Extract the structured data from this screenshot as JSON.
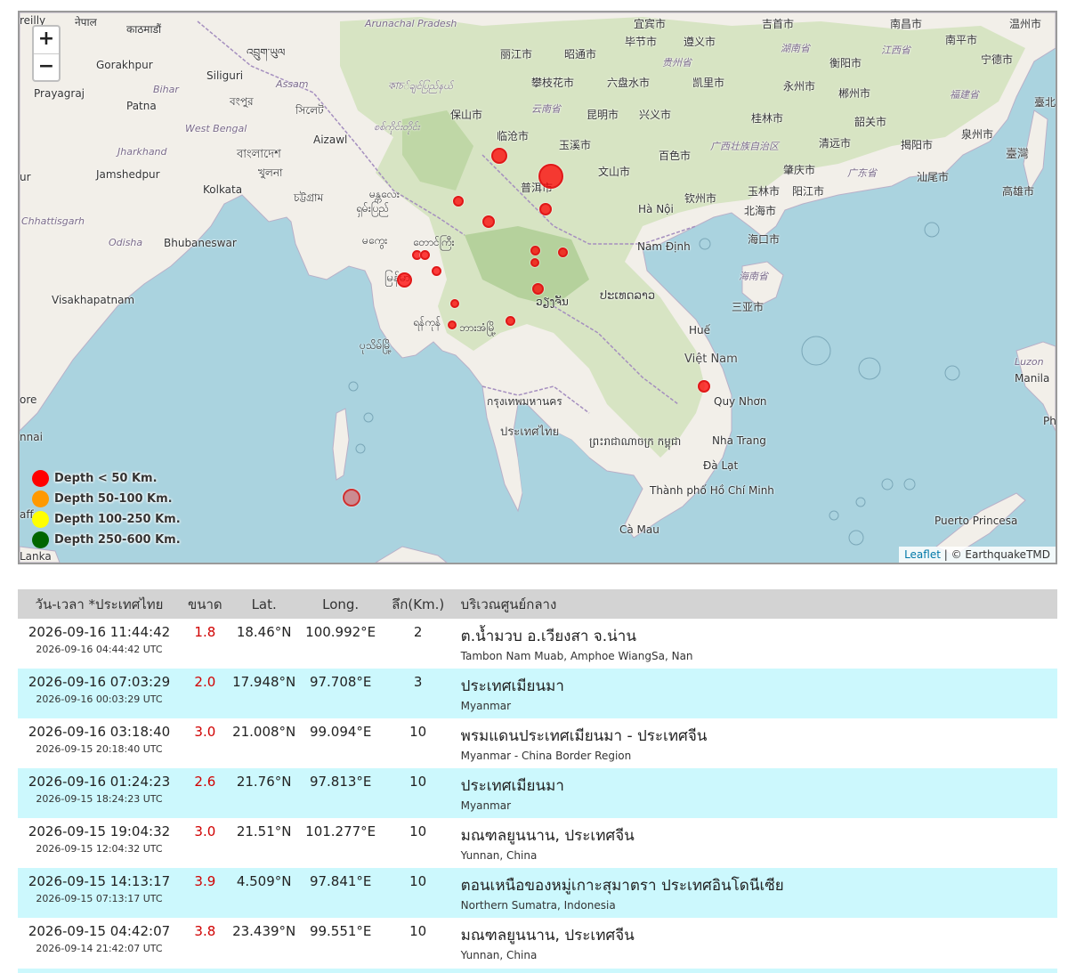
{
  "map": {
    "zoom_in": "+",
    "zoom_out": "−",
    "labels": [
      {
        "text": "reilly",
        "kind": "normal"
      },
      {
        "text": "नेपाल",
        "kind": "normal"
      },
      {
        "text": "काठमाडौं",
        "kind": "normal"
      },
      {
        "text": "Arunachal Pradesh",
        "kind": "italic"
      },
      {
        "text": "宜宾市",
        "kind": "normal"
      },
      {
        "text": "吉首市",
        "kind": "normal"
      },
      {
        "text": "南昌市",
        "kind": "normal"
      },
      {
        "text": "温州市",
        "kind": "normal"
      },
      {
        "text": "Gorakhpur",
        "kind": "normal"
      },
      {
        "text": "འབྲུག་ཡུལ",
        "kind": "normal"
      },
      {
        "text": "丽江市",
        "kind": "normal"
      },
      {
        "text": "昭通市",
        "kind": "normal"
      },
      {
        "text": "毕节市",
        "kind": "normal"
      },
      {
        "text": "遵义市",
        "kind": "normal"
      },
      {
        "text": "湖南省",
        "kind": "italic"
      },
      {
        "text": "南平市",
        "kind": "normal"
      },
      {
        "text": "宁德市",
        "kind": "normal"
      },
      {
        "text": "Prayagraj",
        "kind": "normal"
      },
      {
        "text": "Bihar",
        "kind": "italic"
      },
      {
        "text": "Siliguri",
        "kind": "normal"
      },
      {
        "text": "Assam",
        "kind": "italic"
      },
      {
        "text": "贵州省",
        "kind": "italic"
      },
      {
        "text": "衡阳市",
        "kind": "normal"
      },
      {
        "text": "江西省",
        "kind": "italic"
      },
      {
        "text": "Patna",
        "kind": "normal"
      },
      {
        "text": "বংপুর",
        "kind": "normal"
      },
      {
        "text": "কাচ်ချင်ပြည်နယ်",
        "kind": "italic"
      },
      {
        "text": "攀枝花市",
        "kind": "normal"
      },
      {
        "text": "六盘水市",
        "kind": "normal"
      },
      {
        "text": "凯里市",
        "kind": "normal"
      },
      {
        "text": "永州市",
        "kind": "normal"
      },
      {
        "text": "郴州市",
        "kind": "normal"
      },
      {
        "text": "福建省",
        "kind": "italic"
      },
      {
        "text": "সিলেট",
        "kind": "normal"
      },
      {
        "text": "保山市",
        "kind": "normal"
      },
      {
        "text": "云南省",
        "kind": "italic"
      },
      {
        "text": "昆明市",
        "kind": "normal"
      },
      {
        "text": "兴义市",
        "kind": "normal"
      },
      {
        "text": "桂林市",
        "kind": "normal"
      },
      {
        "text": "韶关市",
        "kind": "normal"
      },
      {
        "text": "泉州市",
        "kind": "normal"
      },
      {
        "text": "臺北",
        "kind": "normal"
      },
      {
        "text": "West Bengal",
        "kind": "italic"
      },
      {
        "text": "Aizawl",
        "kind": "normal"
      },
      {
        "text": "စစ်ကိုင်းတိုင်း",
        "kind": "italic"
      },
      {
        "text": "临沧市",
        "kind": "normal"
      },
      {
        "text": "玉溪市",
        "kind": "normal"
      },
      {
        "text": "广西壮族自治区",
        "kind": "italic"
      },
      {
        "text": "清远市",
        "kind": "normal"
      },
      {
        "text": "揭阳市",
        "kind": "normal"
      },
      {
        "text": "Jharkhand",
        "kind": "italic"
      },
      {
        "text": "বাংলাদেশ",
        "kind": "big"
      },
      {
        "text": "百色市",
        "kind": "normal"
      },
      {
        "text": "臺灣",
        "kind": "big"
      },
      {
        "text": "Jamshedpur",
        "kind": "normal"
      },
      {
        "text": "খুলনা",
        "kind": "normal"
      },
      {
        "text": "文山市",
        "kind": "normal"
      },
      {
        "text": "肇庆市",
        "kind": "normal"
      },
      {
        "text": "广东省",
        "kind": "italic"
      },
      {
        "text": "汕尾市",
        "kind": "normal"
      },
      {
        "text": "高雄市",
        "kind": "normal"
      },
      {
        "text": "Kolkata",
        "kind": "normal"
      },
      {
        "text": "普洱市",
        "kind": "normal"
      },
      {
        "text": "玉林市",
        "kind": "normal"
      },
      {
        "text": "阳江市",
        "kind": "normal"
      },
      {
        "text": "চট্টগ্রাম",
        "kind": "normal"
      },
      {
        "text": "မန္တလေး",
        "kind": "normal"
      },
      {
        "text": "钦州市",
        "kind": "normal"
      },
      {
        "text": "北海市",
        "kind": "normal"
      },
      {
        "text": "Chhattisgarh",
        "kind": "italic"
      },
      {
        "text": "ရှမ်းပြည်",
        "kind": "normal"
      },
      {
        "text": "Hà Nội",
        "kind": "normal"
      },
      {
        "text": "Odisha",
        "kind": "italic"
      },
      {
        "text": "Bhubaneswar",
        "kind": "normal"
      },
      {
        "text": "မကွေး",
        "kind": "normal"
      },
      {
        "text": "တောင်ကြီး",
        "kind": "normal"
      },
      {
        "text": "Nam Định",
        "kind": "normal"
      },
      {
        "text": "海口市",
        "kind": "normal"
      },
      {
        "text": "海南省",
        "kind": "italic"
      },
      {
        "text": "မြန်မာ",
        "kind": "big"
      },
      {
        "text": "ປະເທດລາວ",
        "kind": "big"
      },
      {
        "text": "Visakhapatnam",
        "kind": "normal"
      },
      {
        "text": "ວຽງຈັນ",
        "kind": "normal"
      },
      {
        "text": "三亚市",
        "kind": "normal"
      },
      {
        "text": "ရန်ကုန်",
        "kind": "normal"
      },
      {
        "text": "ဘားအံမြို့",
        "kind": "normal"
      },
      {
        "text": "Huế",
        "kind": "normal"
      },
      {
        "text": "ပုသိမ်မြို့",
        "kind": "normal"
      },
      {
        "text": "Việt Nam",
        "kind": "big"
      },
      {
        "text": "Luzon",
        "kind": "italic"
      },
      {
        "text": "Manila",
        "kind": "normal"
      },
      {
        "text": "ore",
        "kind": "normal"
      },
      {
        "text": "กรุงเทพมหานคร",
        "kind": "normal"
      },
      {
        "text": "Quy Nhơn",
        "kind": "normal"
      },
      {
        "text": "Phi",
        "kind": "normal"
      },
      {
        "text": "ประเทศไทย",
        "kind": "big"
      },
      {
        "text": "nnai",
        "kind": "normal"
      },
      {
        "text": "ព្រះរាជាណាចក្រ កម្ពុជា",
        "kind": "normal"
      },
      {
        "text": "Nha Trang",
        "kind": "normal"
      },
      {
        "text": "Đà Lạt",
        "kind": "normal"
      },
      {
        "text": "Thành phố Hồ Chí Minh",
        "kind": "normal"
      },
      {
        "text": "Cà Mau",
        "kind": "normal"
      },
      {
        "text": "Puerto Princesa",
        "kind": "normal"
      },
      {
        "text": "Lanka",
        "kind": "normal"
      },
      {
        "text": "ur",
        "kind": "normal"
      },
      {
        "text": "aff",
        "kind": "normal"
      }
    ],
    "legend": [
      {
        "label": "Depth < 50 Km.",
        "color": "#ff0000"
      },
      {
        "label": "Depth 50-100 Km.",
        "color": "#ff9900"
      },
      {
        "label": "Depth 100-250 Km.",
        "color": "#ffff00"
      },
      {
        "label": "Depth 250-600 Km.",
        "color": "#006600"
      }
    ],
    "attribution": {
      "link": "Leaflet",
      "text": " | © EarthquakeTMD"
    }
  },
  "table": {
    "headers": {
      "time": "วัน-เวลา *ประเทศไทย",
      "mag": "ขนาด",
      "lat": "Lat.",
      "lon": "Long.",
      "depth": "ลึก(Km.)",
      "region": "บริเวณศูนย์กลาง"
    },
    "rows": [
      {
        "local": "2026-09-16 11:44:42",
        "utc": "2026-09-16 04:44:42 UTC",
        "mag": "1.8",
        "lat": "18.46°N",
        "lon": "100.992°E",
        "depth": "2",
        "region_th": "ต.น้ำมวบ อ.เวียงสา จ.น่าน",
        "region_en": "Tambon Nam Muab, Amphoe WiangSa, Nan"
      },
      {
        "local": "2026-09-16 07:03:29",
        "utc": "2026-09-16 00:03:29 UTC",
        "mag": "2.0",
        "lat": "17.948°N",
        "lon": "97.708°E",
        "depth": "3",
        "region_th": "ประเทศเมียนมา",
        "region_en": "Myanmar"
      },
      {
        "local": "2026-09-16 03:18:40",
        "utc": "2026-09-15 20:18:40 UTC",
        "mag": "3.0",
        "lat": "21.008°N",
        "lon": "99.094°E",
        "depth": "10",
        "region_th": "พรมแดนประเทศเมียนมา - ประเทศจีน",
        "region_en": "Myanmar - China Border Region"
      },
      {
        "local": "2026-09-16 01:24:23",
        "utc": "2026-09-15 18:24:23 UTC",
        "mag": "2.6",
        "lat": "21.76°N",
        "lon": "97.813°E",
        "depth": "10",
        "region_th": "ประเทศเมียนมา",
        "region_en": "Myanmar"
      },
      {
        "local": "2026-09-15 19:04:32",
        "utc": "2026-09-15 12:04:32 UTC",
        "mag": "3.0",
        "lat": "21.51°N",
        "lon": "101.277°E",
        "depth": "10",
        "region_th": "มณฑลยูนนาน, ประเทศจีน",
        "region_en": "Yunnan, China"
      },
      {
        "local": "2026-09-15 14:13:17",
        "utc": "2026-09-15 07:13:17 UTC",
        "mag": "3.9",
        "lat": "4.509°N",
        "lon": "97.841°E",
        "depth": "10",
        "region_th": "ตอนเหนือของหมู่เกาะสุมาตรา ประเทศอินโดนีเซีย",
        "region_en": "Northern Sumatra, Indonesia"
      },
      {
        "local": "2026-09-15 04:42:07",
        "utc": "2026-09-14 21:42:07 UTC",
        "mag": "3.8",
        "lat": "23.439°N",
        "lon": "99.551°E",
        "depth": "10",
        "region_th": "มณฑลยูนนาน, ประเทศจีน",
        "region_en": "Yunnan, China"
      }
    ]
  }
}
